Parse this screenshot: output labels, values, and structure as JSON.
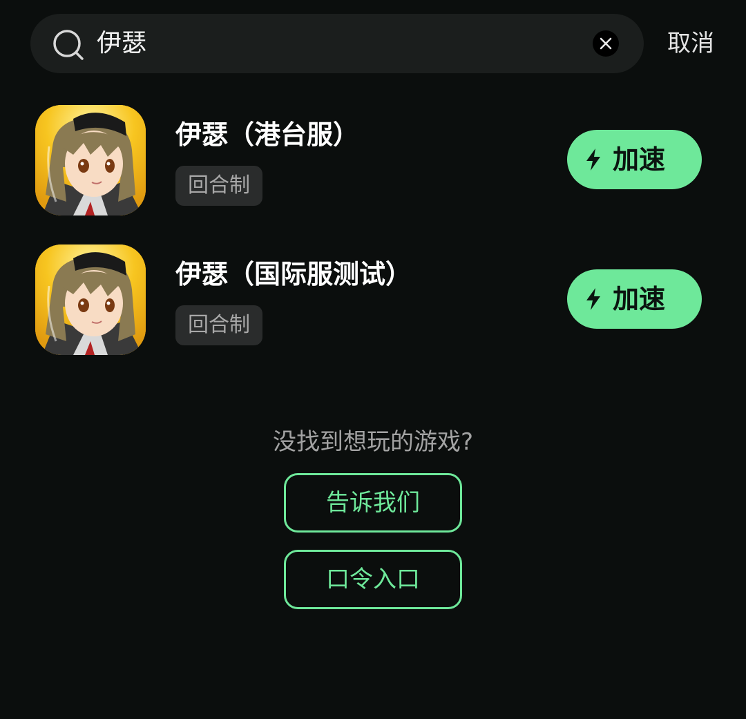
{
  "search": {
    "query": "伊瑟",
    "cancel_label": "取消"
  },
  "results": [
    {
      "title": "伊瑟（港台服）",
      "tag": "回合制",
      "action_label": "加速"
    },
    {
      "title": "伊瑟（国际服测试）",
      "tag": "回合制",
      "action_label": "加速"
    }
  ],
  "footer": {
    "prompt": "没找到想玩的游戏?",
    "feedback_label": "告诉我们",
    "code_entry_label": "口令入口"
  },
  "colors": {
    "background": "#0b0e0d",
    "accent": "#6ee89a",
    "search_bg": "#1b1e1d",
    "tag_bg": "#2a2c2c"
  },
  "icons": {
    "search": "search-icon",
    "clear": "close-icon",
    "boost": "lightning-icon",
    "game": "game-icon"
  }
}
